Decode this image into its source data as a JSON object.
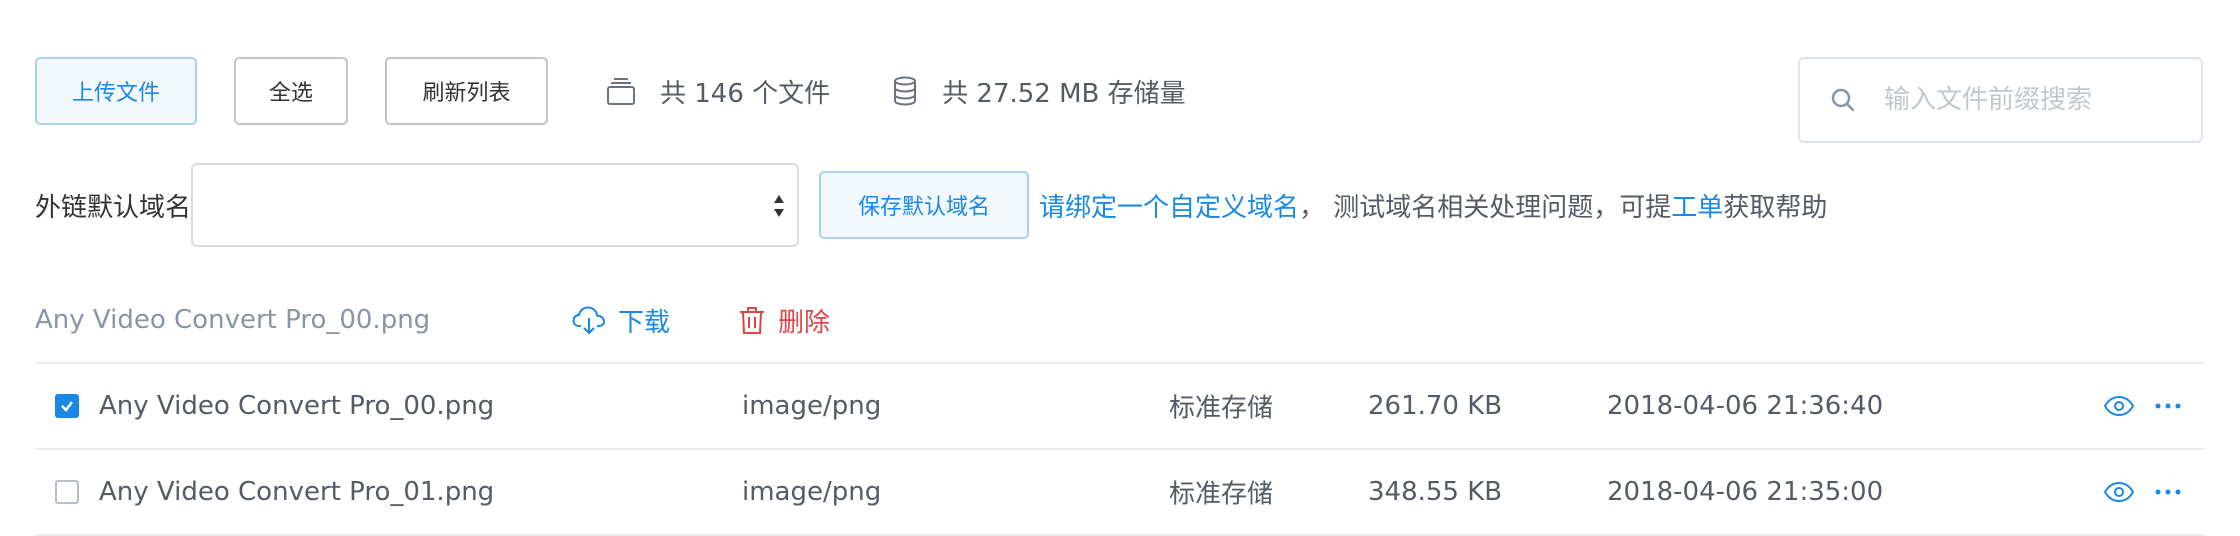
{
  "toolbar": {
    "upload_label": "上传文件",
    "select_all_label": "全选",
    "refresh_label": "刷新列表",
    "file_count_text": "共 146 个文件",
    "storage_text": "共 27.52 MB 存储量"
  },
  "search": {
    "placeholder": "输入文件前缀搜索",
    "value": ""
  },
  "domain": {
    "label": "外链默认域名",
    "selected_value": "",
    "save_label": "保存默认域名",
    "notice_link": "请绑定一个自定义域名",
    "notice_middle": "，  测试域名相关处理问题，可提",
    "notice_ticket": "工单",
    "notice_end": "获取帮助"
  },
  "selection": {
    "selected_name": "Any Video Convert Pro_00.png",
    "download_label": "下载",
    "delete_label": "删除"
  },
  "files": [
    {
      "checked": true,
      "name": "Any Video Convert Pro_00.png",
      "type": "image/png",
      "storage": "标准存储",
      "size": "261.70 KB",
      "time": "2018-04-06 21:36:40"
    },
    {
      "checked": false,
      "name": "Any Video Convert Pro_01.png",
      "type": "image/png",
      "storage": "标准存储",
      "size": "348.55 KB",
      "time": "2018-04-06 21:35:00"
    }
  ],
  "icons": {
    "file_count": "stack-icon",
    "storage": "database-icon",
    "search": "search-icon",
    "download": "cloud-download-icon",
    "delete": "trash-icon",
    "preview": "eye-icon",
    "more": "more-icon"
  },
  "colors": {
    "accent": "#1a88e6",
    "danger": "#e04444",
    "text": "#545b66",
    "muted": "#8a94a6"
  }
}
